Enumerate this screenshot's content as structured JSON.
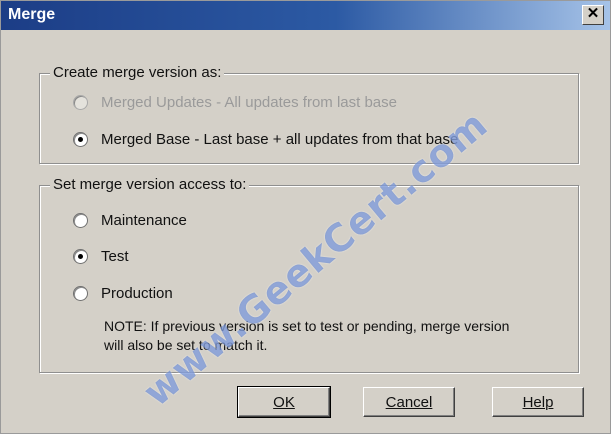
{
  "window": {
    "title": "Merge",
    "close_glyph": "✕"
  },
  "create_group": {
    "legend": "Create merge version as:",
    "options": [
      {
        "label": "Merged Updates - All updates from last base",
        "checked": false,
        "disabled": true
      },
      {
        "label": "Merged Base - Last base + all updates from that base",
        "checked": true,
        "disabled": false
      }
    ]
  },
  "access_group": {
    "legend": "Set merge version access to:",
    "options": [
      {
        "label": "Maintenance",
        "checked": false
      },
      {
        "label": "Test",
        "checked": true
      },
      {
        "label": "Production",
        "checked": false
      }
    ],
    "note_line1": "NOTE:  If previous version is set to test or pending, merge version",
    "note_line2": "will also be set to match it."
  },
  "buttons": {
    "ok": "OK",
    "cancel": "Cancel",
    "help": "Help"
  },
  "watermark": "www.GeekCert.com"
}
